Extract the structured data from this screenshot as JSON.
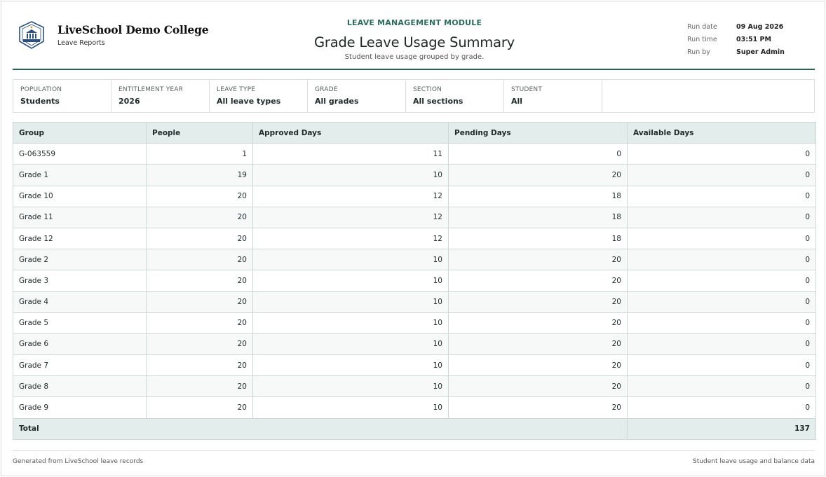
{
  "header": {
    "brand_name": "LiveSchool Demo College",
    "brand_sub": "Leave Reports",
    "module": "LEAVE MANAGEMENT MODULE",
    "title": "Grade Leave Usage Summary",
    "subtitle": "Student leave usage grouped by grade.",
    "meta": [
      {
        "label": "Run date",
        "value": "09 Aug 2026"
      },
      {
        "label": "Run time",
        "value": "03:51 PM"
      },
      {
        "label": "Run by",
        "value": "Super Admin"
      }
    ]
  },
  "filters": [
    {
      "label": "POPULATION",
      "value": "Students"
    },
    {
      "label": "ENTITLEMENT YEAR",
      "value": "2026"
    },
    {
      "label": "LEAVE TYPE",
      "value": "All leave types"
    },
    {
      "label": "GRADE",
      "value": "All grades"
    },
    {
      "label": "SECTION",
      "value": "All sections"
    },
    {
      "label": "STUDENT",
      "value": "All"
    }
  ],
  "table": {
    "columns": [
      "Group",
      "People",
      "Approved Days",
      "Pending Days",
      "Available Days"
    ],
    "rows": [
      [
        "G-063559",
        "1",
        "11",
        "0",
        "0"
      ],
      [
        "Grade 1",
        "19",
        "10",
        "20",
        "0"
      ],
      [
        "Grade 10",
        "20",
        "12",
        "18",
        "0"
      ],
      [
        "Grade 11",
        "20",
        "12",
        "18",
        "0"
      ],
      [
        "Grade 12",
        "20",
        "12",
        "18",
        "0"
      ],
      [
        "Grade 2",
        "20",
        "10",
        "20",
        "0"
      ],
      [
        "Grade 3",
        "20",
        "10",
        "20",
        "0"
      ],
      [
        "Grade 4",
        "20",
        "10",
        "20",
        "0"
      ],
      [
        "Grade 5",
        "20",
        "10",
        "20",
        "0"
      ],
      [
        "Grade 6",
        "20",
        "10",
        "20",
        "0"
      ],
      [
        "Grade 7",
        "20",
        "10",
        "20",
        "0"
      ],
      [
        "Grade 8",
        "20",
        "10",
        "20",
        "0"
      ],
      [
        "Grade 9",
        "20",
        "10",
        "20",
        "0"
      ]
    ],
    "total_label": "Total",
    "total_value": "137"
  },
  "footer": {
    "left": "Generated from LiveSchool leave records",
    "right": "Student leave usage and balance data"
  },
  "colors": {
    "accent": "#2f5d54",
    "module_text": "#2f6b5e",
    "header_bg": "#e3edeb"
  },
  "icons": {
    "logo": "college-crest-icon"
  }
}
